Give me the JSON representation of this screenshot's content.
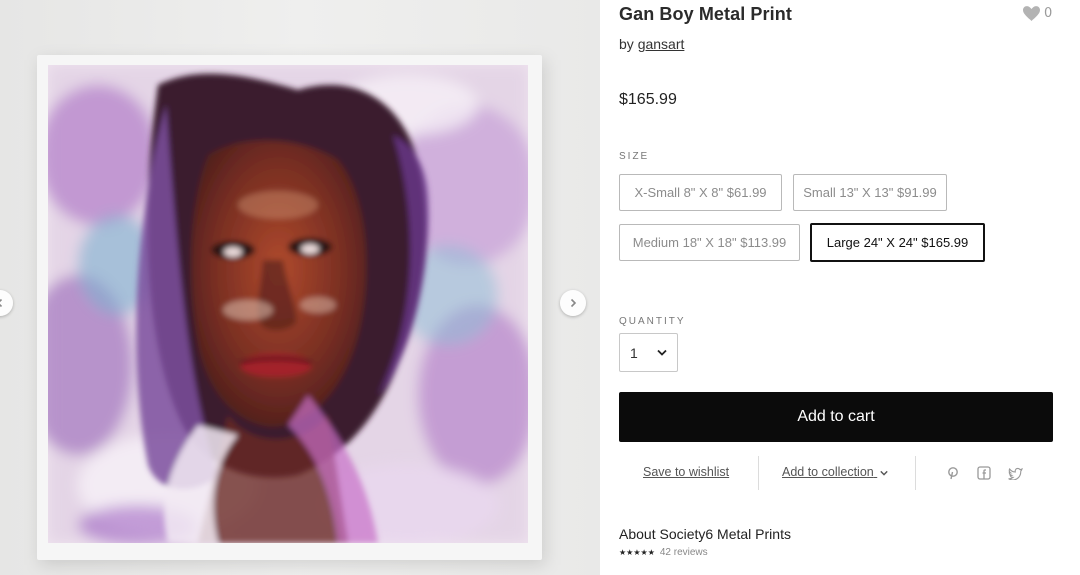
{
  "product": {
    "title": "Gan Boy Metal Print",
    "by_prefix": "by",
    "artist": "gansart",
    "favorites_count": "0",
    "price": "$165.99"
  },
  "size": {
    "label": "SIZE",
    "options": [
      "X-Small 8\" X 8\" $61.99",
      "Small 13\" X 13\" $91.99",
      "Medium 18\" X 18\" $113.99",
      "Large 24\" X 24\" $165.99"
    ],
    "selected": "Large 24\" X 24\" $165.99"
  },
  "quantity": {
    "label": "QUANTITY",
    "value": "1"
  },
  "cart": {
    "add_label": "Add to cart"
  },
  "actions": {
    "wishlist": "Save to wishlist",
    "collection": "Add to collection"
  },
  "about": {
    "title": "About Society6 Metal Prints",
    "stars": "★★★★★",
    "reviews": "42 reviews"
  },
  "icons": {
    "favorite": "heart-icon",
    "prev": "chevron-left-icon",
    "next": "chevron-right-icon",
    "qty_dropdown": "chevron-down-icon",
    "collection_dropdown": "chevron-down-icon",
    "share": [
      "pinterest-icon",
      "facebook-icon",
      "twitter-icon"
    ]
  },
  "colors": {
    "button_bg": "#0b0b0b",
    "selected_border": "#111111",
    "unselected_border": "#b9b9b9",
    "muted_text": "#8c8c8c"
  }
}
